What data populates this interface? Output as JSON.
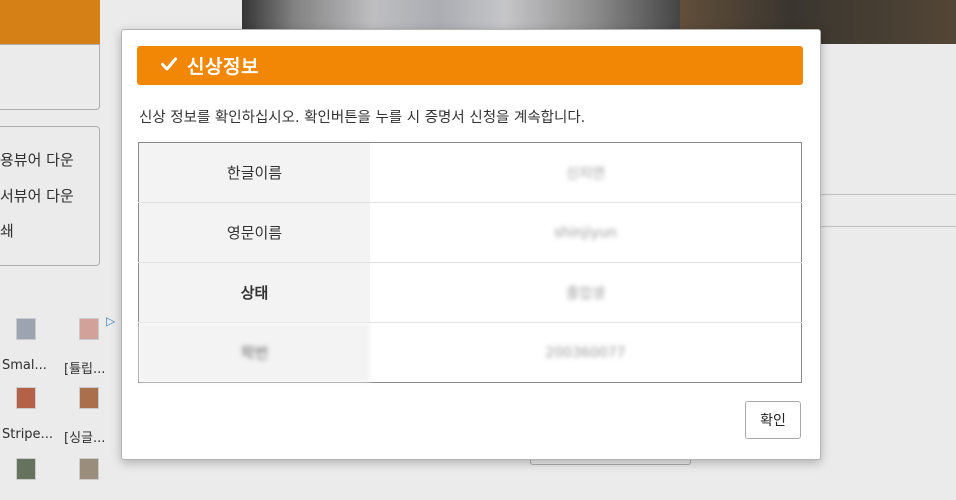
{
  "background": {
    "menu_items": [
      "용뷰어 다운",
      "서뷰어 다운",
      "쇄"
    ],
    "thumb_labels": [
      "Smal...",
      "[튤립...",
      "Stripe...",
      "[싱글..."
    ],
    "ad_marker": "▷"
  },
  "modal": {
    "title": "신상정보",
    "check_icon": "check-icon",
    "description": "신상 정보를 확인하십시오. 확인버튼을 누를 시 증명서 신청을 계속합니다.",
    "rows": [
      {
        "label": "한글이름",
        "value": "신지연"
      },
      {
        "label": "영문이름",
        "value": "shinjiyun"
      },
      {
        "label": "상태",
        "value": "졸업생"
      },
      {
        "label": "학번",
        "value": "200360077"
      }
    ],
    "confirm_label": "확인"
  },
  "colors": {
    "accent": "#f28705"
  }
}
